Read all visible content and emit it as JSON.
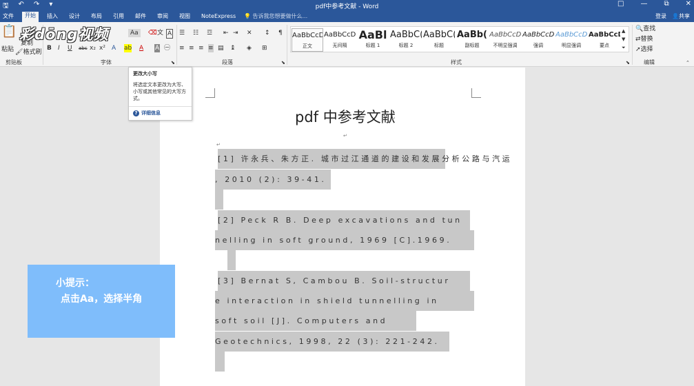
{
  "window": {
    "title": "pdf中参考文献 - Word",
    "controls": [
      "□",
      "—",
      "⧉",
      "✕"
    ]
  },
  "tabs": [
    "文件",
    "开始",
    "插入",
    "设计",
    "布局",
    "引用",
    "邮件",
    "审阅",
    "视图",
    "NoteExpress"
  ],
  "active_tab": "开始",
  "tell_me": "告诉我您想要做什么...",
  "account": {
    "login": "登录",
    "share": "共享"
  },
  "ribbon": {
    "clipboard": {
      "label": "剪贴板",
      "paste": "粘贴",
      "copy": "复制",
      "format_painter": "格式刷"
    },
    "font": {
      "label": "字体",
      "change_case": "Aa",
      "bold": "B",
      "italic": "I",
      "underline": "U",
      "strike": "abc",
      "sub": "x₂",
      "sup": "x²"
    },
    "paragraph": {
      "label": "段落"
    },
    "styles": {
      "label": "样式",
      "items": [
        {
          "preview": "AaBbCcDc",
          "name": "正文"
        },
        {
          "preview": "AaBbCcDc",
          "name": "无间隔"
        },
        {
          "preview": "AaBl",
          "name": "标题 1"
        },
        {
          "preview": "AaBbC(",
          "name": "标题 2"
        },
        {
          "preview": "AaBbC(",
          "name": "标题"
        },
        {
          "preview": "AaBb(",
          "name": "副标题"
        },
        {
          "preview": "AaBbCcD",
          "name": "不明显强调"
        },
        {
          "preview": "AaBbCcDc",
          "name": "强调"
        },
        {
          "preview": "AaBbCcD",
          "name": "明显强调"
        },
        {
          "preview": "AaBbCcD",
          "name": "要点"
        }
      ]
    },
    "editing": {
      "label": "编辑",
      "find": "查找",
      "replace": "替换",
      "select": "选择"
    }
  },
  "logo_text": "彩dōng视频",
  "tooltip": {
    "title": "更改大小写",
    "description": "将选定文本更改为大写、小写或其他常见的大写方式。",
    "more": "详细信息"
  },
  "document": {
    "title": "pdf 中参考文献",
    "lines": [
      "[1]  许永兵、朱方正. 城市过江通道的建设和发展分析公路与汽运",
      ", 2010 (2): 39-41.",
      "",
      "[2] Peck R B. Deep excavations and tun",
      "nelling in soft ground, 1969 [C].1969.",
      "",
      "[3] Bernat S, Cambou B. Soil-structur",
      "e interaction in shield tunnelling in",
      "soft soil [J]. Computers and",
      "Geotechnics, 1998, 22 (3): 221-242.",
      ""
    ]
  },
  "tip": {
    "title": "小提示：",
    "body": "点击Aa，选择半角"
  },
  "colors": {
    "accent": "#2b579a",
    "selection": "#c8c8c8",
    "tip_bg": "#7fbdfb"
  }
}
